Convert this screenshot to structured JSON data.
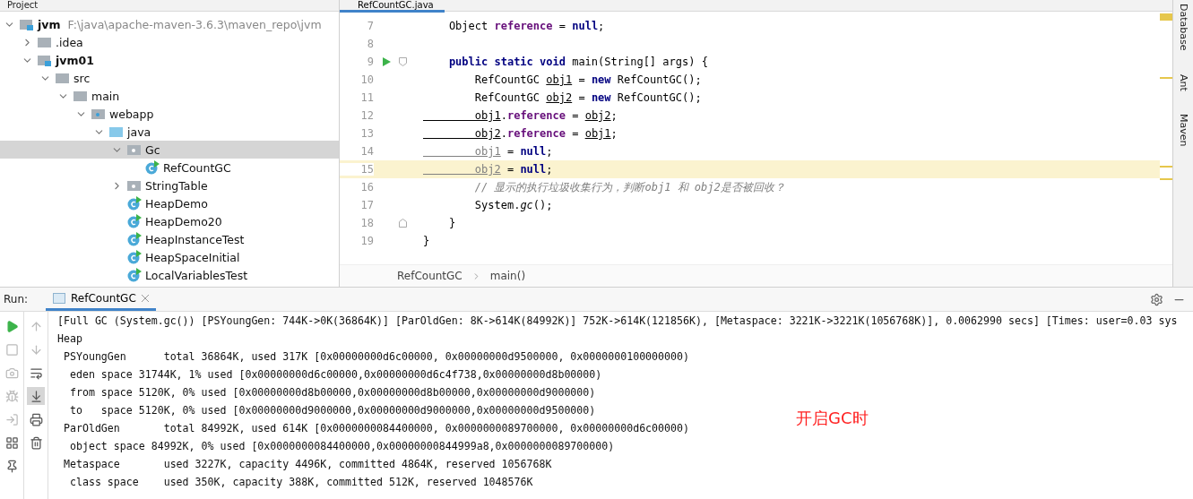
{
  "project_panel": {
    "title": "Project",
    "tree": [
      {
        "label": "jvm",
        "kind": "module",
        "bold": true,
        "hint": "F:\\java\\apache-maven-3.6.3\\maven_repo\\jvm",
        "expanded": true,
        "selected": false,
        "children": [
          {
            "label": ".idea",
            "kind": "folder",
            "bold": false,
            "expanded": false,
            "selected": false
          },
          {
            "label": "jvm01",
            "kind": "module",
            "bold": true,
            "expanded": true,
            "selected": false,
            "children": [
              {
                "label": "src",
                "kind": "folder",
                "bold": false,
                "expanded": true,
                "selected": false,
                "children": [
                  {
                    "label": "main",
                    "kind": "folder",
                    "bold": false,
                    "expanded": true,
                    "selected": false,
                    "children": [
                      {
                        "label": "webapp",
                        "kind": "web-folder",
                        "bold": false,
                        "expanded": true,
                        "selected": false,
                        "children": [
                          {
                            "label": "java",
                            "kind": "source-folder",
                            "bold": false,
                            "expanded": true,
                            "selected": false,
                            "children": [
                              {
                                "label": "Gc",
                                "kind": "package",
                                "bold": false,
                                "expanded": true,
                                "selected": true,
                                "children": [
                                  {
                                    "label": "RefCountGC",
                                    "kind": "class",
                                    "bold": false,
                                    "selected": false
                                  }
                                ]
                              },
                              {
                                "label": "StringTable",
                                "kind": "package",
                                "bold": false,
                                "expanded": false,
                                "selected": false
                              },
                              {
                                "label": "HeapDemo",
                                "kind": "class",
                                "bold": false,
                                "selected": false
                              },
                              {
                                "label": "HeapDemo20",
                                "kind": "class",
                                "bold": false,
                                "selected": false
                              },
                              {
                                "label": "HeapInstanceTest",
                                "kind": "class",
                                "bold": false,
                                "selected": false
                              },
                              {
                                "label": "HeapSpaceInitial",
                                "kind": "class",
                                "bold": false,
                                "selected": false
                              },
                              {
                                "label": "LocalVariablesTest",
                                "kind": "class",
                                "bold": false,
                                "selected": false
                              }
                            ]
                          }
                        ]
                      }
                    ]
                  }
                ]
              }
            ]
          }
        ]
      }
    ]
  },
  "editor": {
    "tab": {
      "label": "RefCountGC.java",
      "selected": true
    },
    "lines": [
      {
        "number": "7",
        "current": false,
        "tokens": [
          {
            "kind": "plain",
            "text": "    Object "
          },
          {
            "kind": "field",
            "text": "reference"
          },
          {
            "kind": "plain",
            "text": " = "
          },
          {
            "kind": "keyword",
            "text": "null"
          },
          {
            "kind": "plain",
            "text": ";"
          }
        ]
      },
      {
        "number": "8",
        "current": false
      },
      {
        "number": "9",
        "current": false,
        "run_marker": true,
        "fold_start": true,
        "tokens": [
          {
            "kind": "keyword",
            "text": "    public static void "
          },
          {
            "kind": "plain",
            "text": "main(String[] args) {"
          }
        ]
      },
      {
        "number": "10",
        "current": false,
        "tokens": [
          {
            "kind": "plain",
            "text": "        RefCountGC "
          },
          {
            "kind": "var",
            "text": "obj1"
          },
          {
            "kind": "plain",
            "text": " = "
          },
          {
            "kind": "keyword",
            "text": "new "
          },
          {
            "kind": "plain",
            "text": "RefCountGC();"
          }
        ]
      },
      {
        "number": "11",
        "current": false,
        "tokens": [
          {
            "kind": "plain",
            "text": "        RefCountGC "
          },
          {
            "kind": "var",
            "text": "obj2"
          },
          {
            "kind": "plain",
            "text": " = "
          },
          {
            "kind": "keyword",
            "text": "new "
          },
          {
            "kind": "plain",
            "text": "RefCountGC();"
          }
        ]
      },
      {
        "number": "12",
        "current": false,
        "tokens": [
          {
            "kind": "var",
            "text": "        obj1"
          },
          {
            "kind": "plain",
            "text": "."
          },
          {
            "kind": "field",
            "text": "reference"
          },
          {
            "kind": "plain",
            "text": " = "
          },
          {
            "kind": "var",
            "text": "obj2"
          },
          {
            "kind": "plain",
            "text": ";"
          }
        ]
      },
      {
        "number": "13",
        "current": false,
        "tokens": [
          {
            "kind": "var",
            "text": "        obj2"
          },
          {
            "kind": "plain",
            "text": "."
          },
          {
            "kind": "field",
            "text": "reference"
          },
          {
            "kind": "plain",
            "text": " = "
          },
          {
            "kind": "var",
            "text": "obj1"
          },
          {
            "kind": "plain",
            "text": ";"
          }
        ]
      },
      {
        "number": "14",
        "current": false,
        "tokens": [
          {
            "kind": "unused",
            "text": "        obj1"
          },
          {
            "kind": "plain",
            "text": " = "
          },
          {
            "kind": "keyword",
            "text": "null"
          },
          {
            "kind": "plain",
            "text": ";"
          }
        ]
      },
      {
        "number": "15",
        "current": true,
        "tokens": [
          {
            "kind": "unused",
            "text": "        obj2"
          },
          {
            "kind": "plain",
            "text": " = "
          },
          {
            "kind": "keyword",
            "text": "null"
          },
          {
            "kind": "plain",
            "text": ";"
          }
        ]
      },
      {
        "number": "16",
        "current": false,
        "tokens": [
          {
            "kind": "comment",
            "text": "        // 显示的执行垃圾收集行为，判断obj1 和 obj2是否被回收？"
          }
        ]
      },
      {
        "number": "17",
        "current": false,
        "tokens": [
          {
            "kind": "plain",
            "text": "        System."
          },
          {
            "kind": "static",
            "text": "gc"
          },
          {
            "kind": "plain",
            "text": "();"
          }
        ]
      },
      {
        "number": "18",
        "current": false,
        "fold_end": true,
        "tokens": [
          {
            "kind": "plain",
            "text": "    }"
          }
        ]
      },
      {
        "number": "19",
        "current": false,
        "tokens": [
          {
            "kind": "plain",
            "text": "}"
          }
        ]
      }
    ],
    "breadcrumbs": [
      "RefCountGC",
      "main()"
    ]
  },
  "right_toolbar": [
    "Database",
    "Ant",
    "Maven"
  ],
  "run_panel": {
    "label": "Run:",
    "tab": {
      "label": "RefCountGC",
      "selected": true
    },
    "tools_left": [
      {
        "kind": "run",
        "disabled": false
      },
      {
        "kind": "stop",
        "disabled": true
      },
      {
        "kind": "camera",
        "disabled": true
      },
      {
        "kind": "bug",
        "disabled": true
      },
      {
        "kind": "login",
        "disabled": true
      },
      {
        "kind": "layout",
        "disabled": false
      },
      {
        "kind": "pin",
        "disabled": false
      }
    ],
    "tools_right": [
      {
        "kind": "up",
        "disabled": true,
        "selected": false
      },
      {
        "kind": "down",
        "disabled": true,
        "selected": false
      },
      {
        "kind": "wrap",
        "disabled": false,
        "selected": false
      },
      {
        "kind": "scroll-end",
        "disabled": false,
        "selected": true
      },
      {
        "kind": "print",
        "disabled": false,
        "selected": false
      },
      {
        "kind": "trash",
        "disabled": false,
        "selected": false
      }
    ],
    "console": [
      "[Full GC (System.gc()) [PSYoungGen: 744K->0K(36864K)] [ParOldGen: 8K->614K(84992K)] 752K->614K(121856K), [Metaspace: 3221K->3221K(1056768K)], 0.0062990 secs] [Times: user=0.03 sys",
      "Heap",
      " PSYoungGen      total 36864K, used 317K [0x00000000d6c00000, 0x00000000d9500000, 0x0000000100000000)",
      "  eden space 31744K, 1% used [0x00000000d6c00000,0x00000000d6c4f738,0x00000000d8b00000)",
      "  from space 5120K, 0% used [0x00000000d8b00000,0x00000000d8b00000,0x00000000d9000000)",
      "  to   space 5120K, 0% used [0x00000000d9000000,0x00000000d9000000,0x00000000d9500000)",
      " ParOldGen       total 84992K, used 614K [0x0000000084400000, 0x0000000089700000, 0x00000000d6c00000)",
      "  object space 84992K, 0% used [0x0000000084400000,0x00000000844999a8,0x0000000089700000)",
      " Metaspace       used 3227K, capacity 4496K, committed 4864K, reserved 1056768K",
      "  class space    used 350K, capacity 388K, committed 512K, reserved 1048576K"
    ],
    "annotation": "开启GC时"
  }
}
